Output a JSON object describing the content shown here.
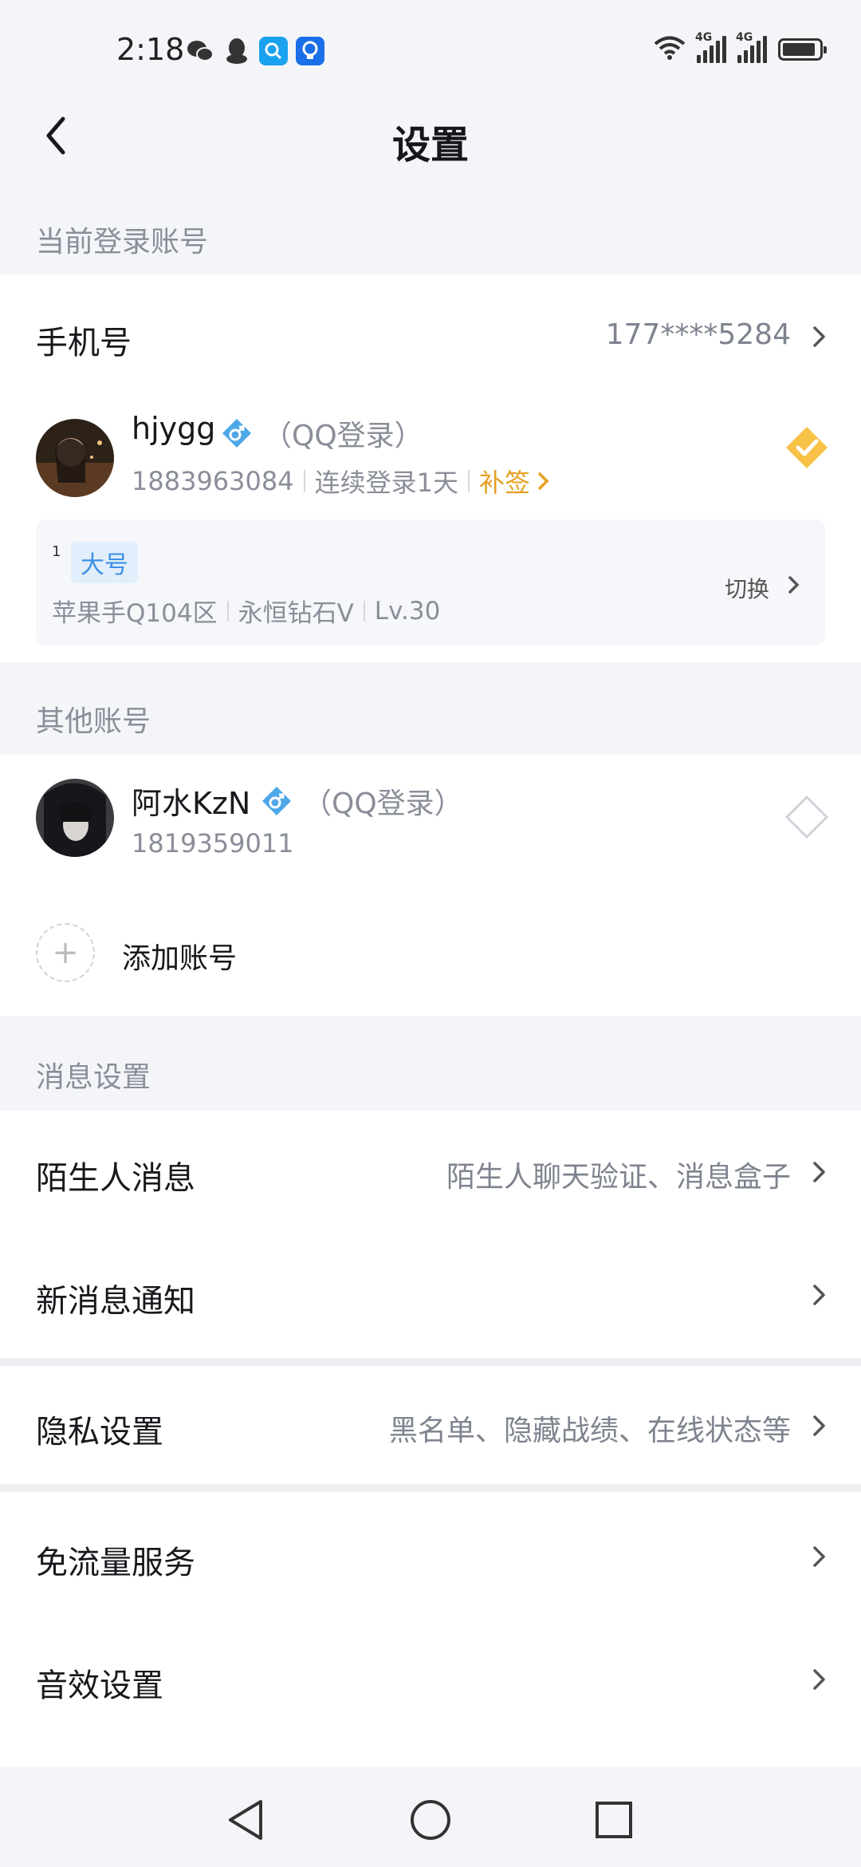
{
  "status_bar": {
    "time": "2:18",
    "network1": "4G",
    "network2": "4G",
    "battery_level": 0.9,
    "app_icons": [
      "wechat-icon",
      "qq-icon",
      "search-app-icon",
      "bulb-app-icon"
    ]
  },
  "nav": {
    "title": "设置"
  },
  "current_account": {
    "section_label": "当前登录账号",
    "phone_label": "手机号",
    "phone_value": "177****5284",
    "account": {
      "name": "hjygg",
      "login_type": "（QQ登录）",
      "qq": "1883963084",
      "streak": "连续登录1天",
      "checkin": "补签",
      "selected": true
    },
    "game": {
      "index": "1",
      "tag": "大号",
      "server": "苹果手Q104区",
      "rank": "永恒钻石V",
      "level": "Lv.30",
      "switch_label": "切换"
    }
  },
  "other_accounts": {
    "section_label": "其他账号",
    "account": {
      "name": "阿水KzN",
      "login_type": "（QQ登录）",
      "qq": "1819359011",
      "selected": false
    },
    "add_label": "添加账号"
  },
  "message_settings": {
    "section_label": "消息设置",
    "stranger": {
      "label": "陌生人消息",
      "value": "陌生人聊天验证、消息盒子"
    },
    "notify": {
      "label": "新消息通知"
    }
  },
  "privacy": {
    "label": "隐私设置",
    "value": "黑名单、隐藏战绩、在线状态等"
  },
  "free_data": {
    "label": "免流量服务"
  },
  "sound": {
    "label": "音效设置"
  },
  "colors": {
    "accent_orange": "#e6a023",
    "accent_blue": "#3d8fe6"
  }
}
